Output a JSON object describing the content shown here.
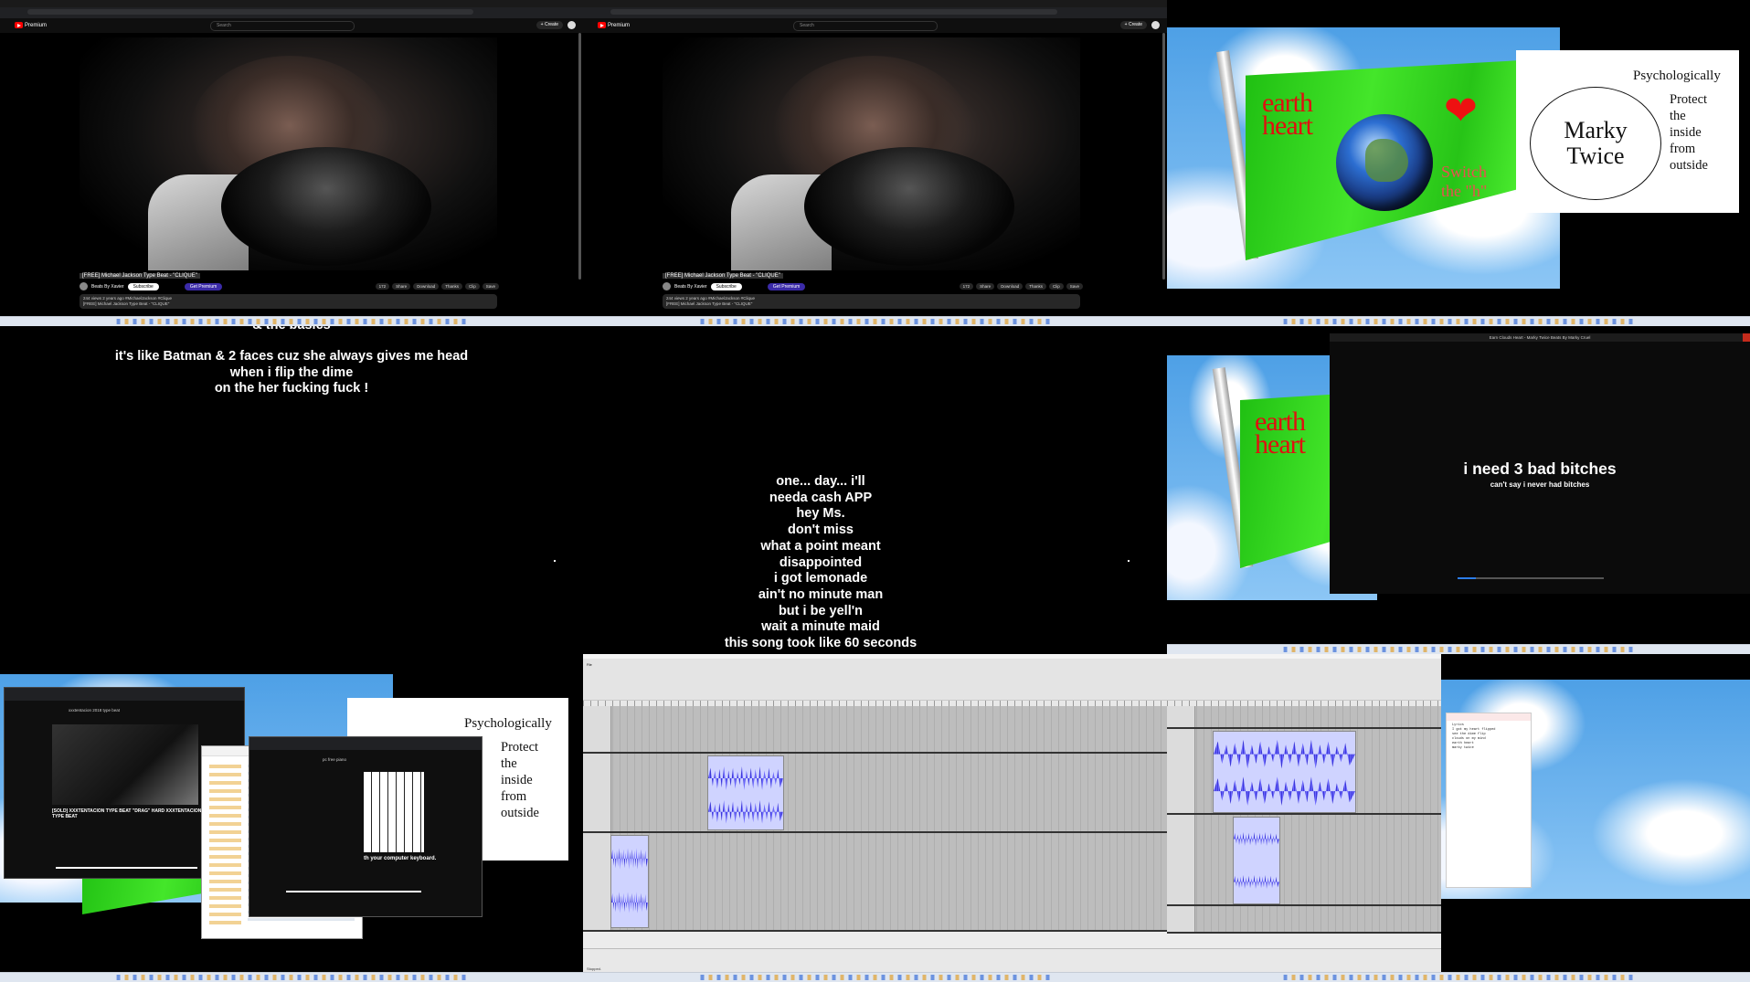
{
  "youtube": {
    "brand": "Premium",
    "search_placeholder": "Search",
    "create_label": "+ Create",
    "video_title": "[FREE] Michael Jackson Type Beat - \"CLIQUE\"",
    "channel_name": "Beats By Xavier",
    "channel_subs": "1.6K subscribers",
    "subscribe_label": "Subscribe",
    "pill_label": "Get Premium",
    "actions": [
      "172",
      "Share",
      "Download",
      "Thanks",
      "Clip",
      "Save"
    ],
    "desc_line1": "244 views  2 years ago  #MichaelJackson #Clique",
    "desc_line2": "[FREE] Michael Jackson Type Beat - \"CLIQUE\""
  },
  "flag": {
    "line1": "earth",
    "line2": "heart",
    "switch1": "Switch",
    "switch2": "the \"h\""
  },
  "paper": {
    "top": "Psychologically",
    "circle1": "Marky",
    "circle2": "Twice",
    "side": [
      "Protect",
      "the",
      "inside",
      "from",
      "outside"
    ]
  },
  "lyrics_left": {
    "cut": "& the basics",
    "lines": [
      "it's like Batman & 2 faces cuz she always gives me head",
      "when i flip the dime",
      "on the her fucking fuck !"
    ]
  },
  "lyrics_mid": {
    "lines": [
      "one... day... i'll",
      "needa cash APP",
      "hey Ms.",
      "don't miss",
      "what a point meant",
      "disappointed",
      "i got lemonade",
      "ain't no minute man",
      "but i be yell'n",
      "wait a minute maid",
      "this song took like 60 seconds"
    ]
  },
  "player": {
    "title": "Earn Clouds Heart - Marky Twice Beats By Marky Cruel",
    "big": "i need 3 bad bitches",
    "small": "can't say i never had bitches"
  },
  "collage": {
    "yt_title": "[SOLD] XXXTENTACION TYPE BEAT \"DRAG\" HARD XXXTENTACION TYPE BEAT",
    "yt_search": "xxxtentacion 2018 type beat",
    "piano_caption": "th your computer keyboard.",
    "piano_search": "pc free piano"
  },
  "audacity": {
    "menus": [
      "File",
      "Edit",
      "Select",
      "View",
      "Transport",
      "Tracks",
      "Generate",
      "Effect",
      "Analyze",
      "Tools",
      "Help"
    ],
    "status": "Stopped."
  },
  "notepad": {
    "text": "Lyrics\nI got my heart flipped\nsee the dime flip\nclouds on my mind\nearth heart\nmarky twice"
  }
}
